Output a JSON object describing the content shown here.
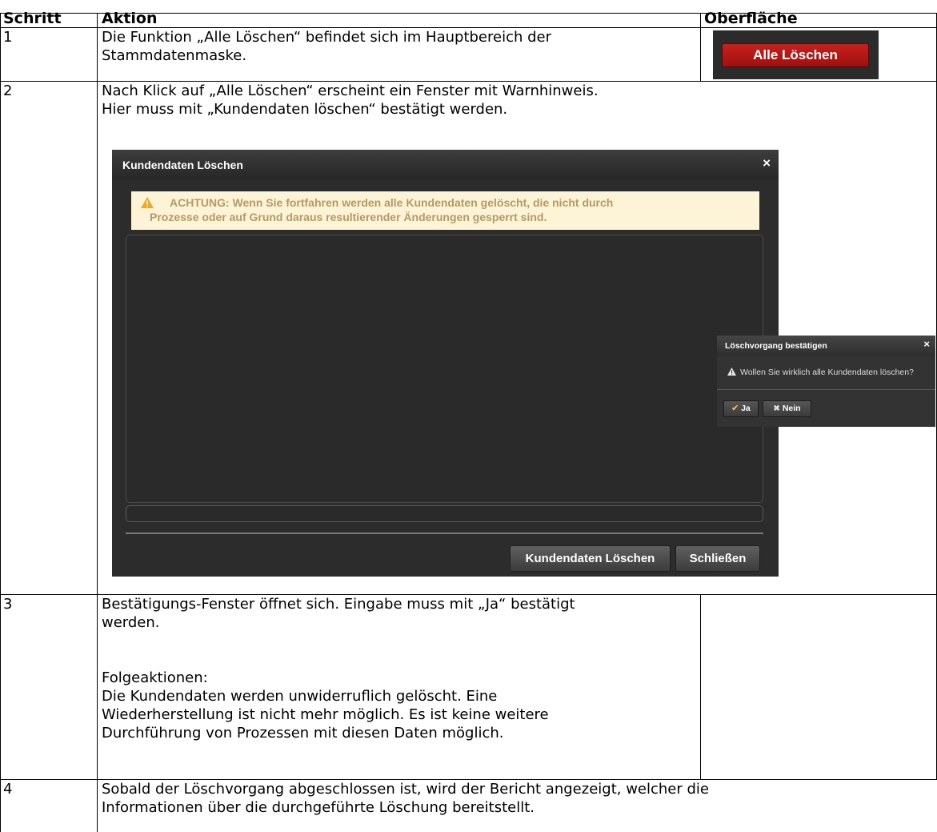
{
  "table": {
    "headers": {
      "step": "Schritt",
      "action": "Aktion",
      "ui": "Oberfläche"
    },
    "rows": [
      {
        "step": "1",
        "action_lines": [
          "Die Funktion „Alle Löschen“ befindet sich im Hauptbereich der",
          "Stammdatenmaske."
        ]
      },
      {
        "step": "2",
        "action_lines": [
          "Nach Klick auf „Alle Löschen“ erscheint ein Fenster mit Warnhinweis.",
          "Hier muss mit „Kundendaten löschen“ bestätigt werden."
        ]
      },
      {
        "step": "3",
        "action_lines": [
          "Bestätigungs-Fenster öffnet sich. Eingabe muss mit „Ja“ bestätigt",
          "werden."
        ],
        "followup_lines": [
          "Folgeaktionen:",
          "Die Kundendaten werden unwiderruflich gelöscht. Eine",
          "Wiederherstellung ist nicht mehr möglich. Es ist keine weitere",
          "Durchführung von Prozessen mit diesen Daten möglich."
        ]
      },
      {
        "step": "4",
        "action_lines": [
          "Sobald der Löschvorgang abgeschlossen ist, wird der Bericht angezeigt, welcher die",
          "Informationen über die durchgeführte Löschung bereitstellt."
        ]
      }
    ]
  },
  "alle_loeschen_button": {
    "label": "Alle Löschen",
    "color": "#b51815"
  },
  "delete_dialog": {
    "title": "Kundendaten Löschen",
    "close_glyph": "×",
    "warning_lines": [
      "ACHTUNG: Wenn Sie fortfahren werden alle Kundendaten gelöscht, die nicht durch",
      "Prozesse oder auf Grund daraus resultierender Änderungen gesperrt sind."
    ],
    "warning_icon": "warning-triangle-icon",
    "buttons": {
      "confirm": "Kundendaten Löschen",
      "close": "Schließen"
    }
  },
  "confirm_dialog": {
    "title": "Löschvorgang bestätigen",
    "close_glyph": "×",
    "message": "Wollen Sie wirklich alle Kundendaten löschen?",
    "buttons": {
      "yes": "Ja",
      "no": "Nein"
    }
  }
}
